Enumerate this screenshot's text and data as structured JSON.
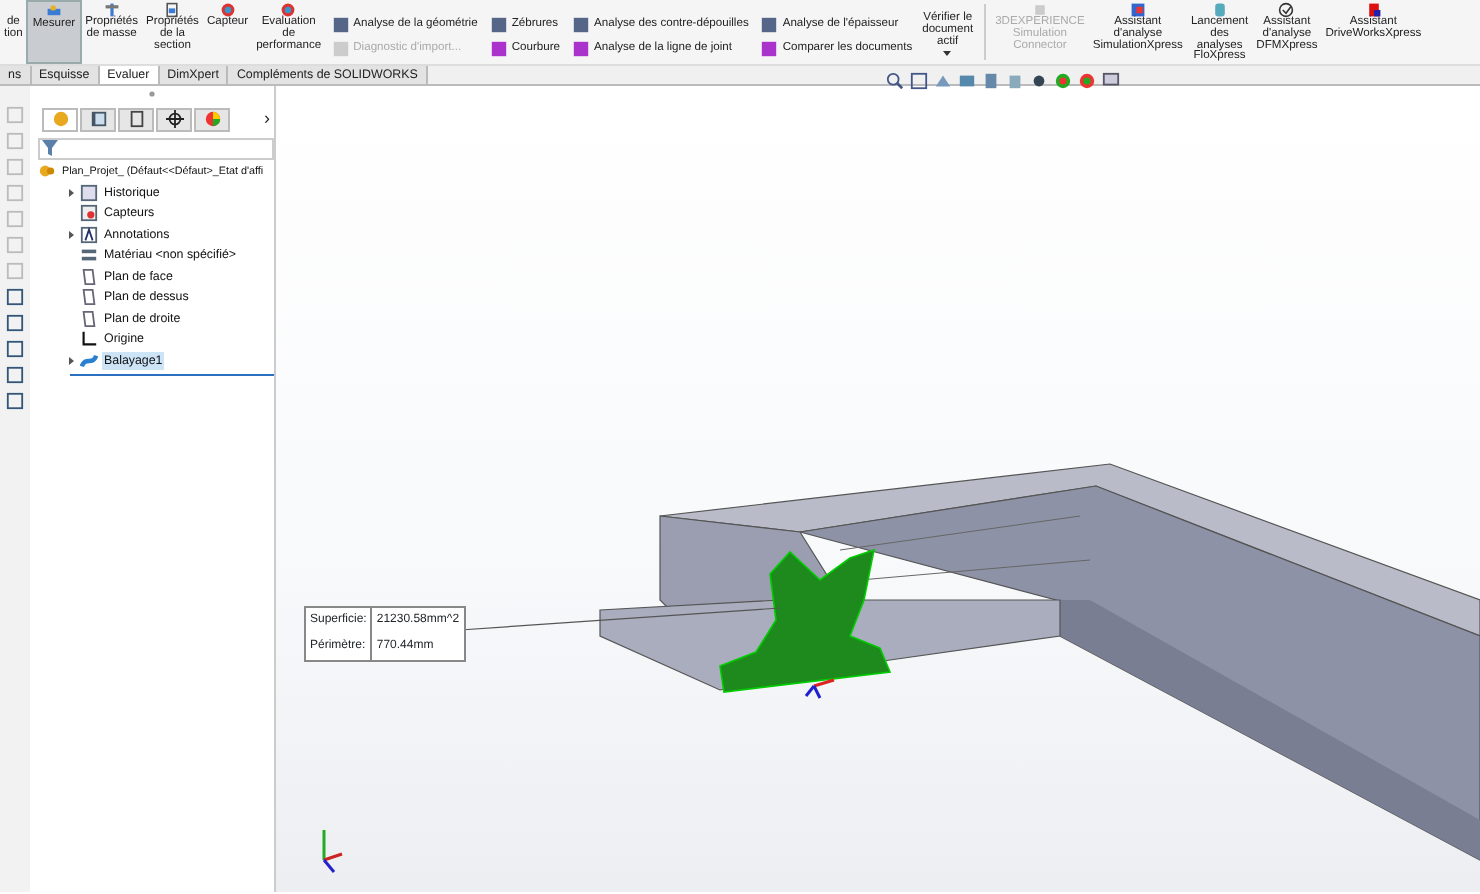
{
  "ribbon": {
    "groups": [
      {
        "kind": "large",
        "label": "de tion",
        "selected": false,
        "disabled": false
      },
      {
        "kind": "large",
        "label": "Mesurer",
        "selected": true,
        "disabled": false
      },
      {
        "kind": "large",
        "label": "Propriétés de masse",
        "selected": false,
        "disabled": false
      },
      {
        "kind": "large",
        "label": "Propriétés de la section",
        "selected": false,
        "disabled": false
      },
      {
        "kind": "large",
        "label": "Capteur",
        "selected": false,
        "disabled": false
      },
      {
        "kind": "large",
        "label": "Evaluation de performance",
        "selected": false,
        "disabled": false
      },
      {
        "kind": "column",
        "items": [
          {
            "label": "Analyse de la géométrie",
            "disabled": false
          },
          {
            "label": "Diagnostic d'import...",
            "disabled": true
          }
        ]
      },
      {
        "kind": "column",
        "items": [
          {
            "label": "Zébrures",
            "disabled": false
          },
          {
            "label": "Courbure",
            "disabled": false
          }
        ]
      },
      {
        "kind": "column",
        "items": [
          {
            "label": "Analyse des contre-dépouilles",
            "disabled": false
          },
          {
            "label": "Analyse de la ligne de joint",
            "disabled": false
          }
        ]
      },
      {
        "kind": "column",
        "items": [
          {
            "label": "Analyse de l'épaisseur",
            "disabled": false
          },
          {
            "label": "Comparer les documents",
            "disabled": false
          }
        ]
      },
      {
        "kind": "dropdown",
        "label": "Vérifier le document actif",
        "selected": false,
        "disabled": false
      },
      {
        "kind": "separator"
      },
      {
        "kind": "large",
        "label": "3DEXPERIENCE Simulation Connector",
        "selected": false,
        "disabled": true
      },
      {
        "kind": "large",
        "label": "Assistant d'analyse SimulationXpress",
        "selected": false,
        "disabled": false
      },
      {
        "kind": "large",
        "label": "Lancement des analyses FloXpress",
        "selected": false,
        "disabled": false
      },
      {
        "kind": "large",
        "label": "Assistant d'analyse DFMXpress",
        "selected": false,
        "disabled": false
      },
      {
        "kind": "large",
        "label": "Assistant DriveWorksXpress",
        "selected": false,
        "disabled": false
      }
    ]
  },
  "tabs": [
    {
      "label": "ns",
      "selected": false
    },
    {
      "label": "Esquisse",
      "selected": false
    },
    {
      "label": "Evaluer",
      "selected": true
    },
    {
      "label": "DimXpert",
      "selected": false
    },
    {
      "label": "Compléments de SOLIDWORKS",
      "selected": false
    }
  ],
  "panel_tabs": [
    {
      "kind": "features",
      "selected": true
    },
    {
      "kind": "properties",
      "selected": false
    },
    {
      "kind": "config",
      "selected": false
    },
    {
      "kind": "dimxpert",
      "selected": false
    },
    {
      "kind": "display",
      "selected": false
    }
  ],
  "panel_more": "›",
  "tree": [
    {
      "kind": "part",
      "label": "Plan_Projet_  (Défaut<<Défaut>_Etat d'affi",
      "expandable": false,
      "selected": false
    },
    {
      "kind": "history",
      "label": "Historique",
      "expandable": true,
      "selected": false
    },
    {
      "kind": "sensors",
      "label": "Capteurs",
      "expandable": false,
      "selected": false
    },
    {
      "kind": "annotations",
      "label": "Annotations",
      "expandable": true,
      "selected": false
    },
    {
      "kind": "material",
      "label": "Matériau <non spécifié>",
      "expandable": false,
      "selected": false
    },
    {
      "kind": "plane",
      "label": "Plan de face",
      "expandable": false,
      "selected": false
    },
    {
      "kind": "plane",
      "label": "Plan de dessus",
      "expandable": false,
      "selected": false
    },
    {
      "kind": "plane",
      "label": "Plan de droite",
      "expandable": false,
      "selected": false
    },
    {
      "kind": "origin",
      "label": "Origine",
      "expandable": false,
      "selected": false
    },
    {
      "kind": "feature",
      "label": "Balayage1",
      "expandable": true,
      "selected": true
    }
  ],
  "callout": {
    "rows": [
      {
        "label": "Superficie:",
        "value": "21230.58mm^2"
      },
      {
        "label": "Périmètre:",
        "value": "770.44mm"
      }
    ]
  }
}
